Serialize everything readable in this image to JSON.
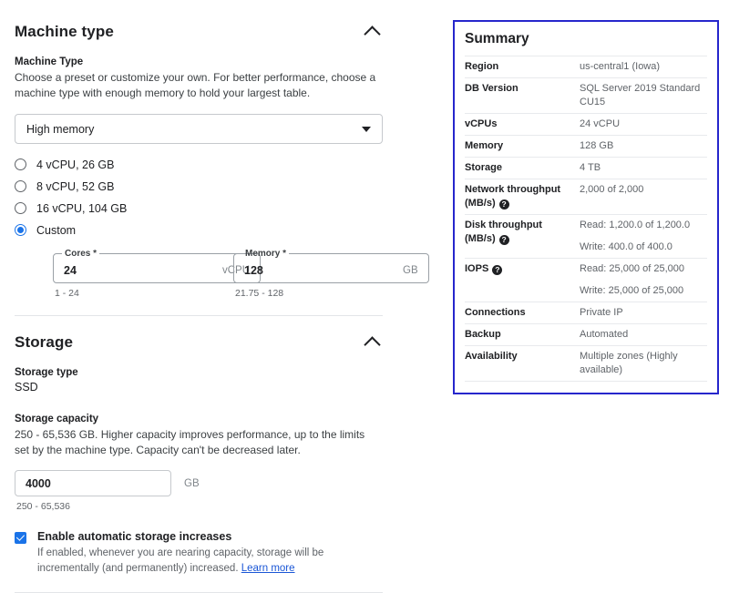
{
  "machine_type": {
    "section_title": "Machine type",
    "collapse_icon": "chevron-up-icon",
    "field_label": "Machine Type",
    "field_desc": "Choose a preset or customize your own. For better performance, choose a machine type with enough memory to hold your largest table.",
    "preset_select": {
      "value": "High memory",
      "caret_icon": "chevron-down-icon"
    },
    "options": [
      {
        "label": "4 vCPU, 26 GB",
        "selected": false
      },
      {
        "label": "8 vCPU, 52 GB",
        "selected": false
      },
      {
        "label": "16 vCPU, 104 GB",
        "selected": false
      },
      {
        "label": "Custom",
        "selected": true
      }
    ],
    "cores_field": {
      "legend": "Cores *",
      "value": "24",
      "suffix": "vCPU",
      "hint": "1 - 24"
    },
    "memory_field": {
      "legend": "Memory *",
      "value": "128",
      "suffix": "GB",
      "hint": "21.75 - 128"
    }
  },
  "storage": {
    "section_title": "Storage",
    "collapse_icon": "chevron-up-icon",
    "type_label": "Storage type",
    "type_value": "SSD",
    "capacity_label": "Storage capacity",
    "capacity_desc": "250 - 65,536 GB. Higher capacity improves performance, up to the limits set by the machine type. Capacity can't be decreased later.",
    "capacity_field": {
      "value": "4000",
      "suffix": "GB",
      "hint": "250 - 65,536"
    },
    "auto_increase": {
      "checked": true,
      "title": "Enable automatic storage increases",
      "desc_before": "If enabled, whenever you are nearing capacity, storage will be incrementally (and permanently) increased. ",
      "link_label": "Learn more"
    }
  },
  "summary": {
    "title": "Summary",
    "border_color": "#2626cc",
    "rows": [
      {
        "key": "Region",
        "value": "us-central1 (Iowa)",
        "help": false
      },
      {
        "key": "DB Version",
        "value": "SQL Server 2019 Standard CU15",
        "help": false
      },
      {
        "key": "vCPUs",
        "value": "24 vCPU",
        "help": false
      },
      {
        "key": "Memory",
        "value": "128 GB",
        "help": false
      },
      {
        "key": "Storage",
        "value": "4 TB",
        "help": false
      },
      {
        "key": "Network throughput (MB/s)",
        "value": "2,000 of 2,000",
        "help": true
      },
      {
        "key": "Disk throughput (MB/s)",
        "value": "Read: 1,200.0 of 1,200.0",
        "value2": "Write: 400.0 of 400.0",
        "help": true
      },
      {
        "key": "IOPS",
        "value": "Read: 25,000 of 25,000",
        "value2": "Write: 25,000 of 25,000",
        "help": true
      },
      {
        "key": "Connections",
        "value": "Private IP",
        "help": false
      },
      {
        "key": "Backup",
        "value": "Automated",
        "help": false
      },
      {
        "key": "Availability",
        "value": "Multiple zones (Highly available)",
        "help": false
      }
    ],
    "help_glyph": "?"
  }
}
